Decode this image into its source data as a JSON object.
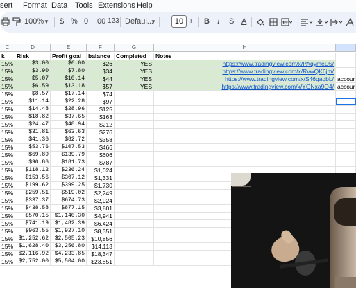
{
  "menu": [
    "sert",
    "Format",
    "Data",
    "Tools",
    "Extensions",
    "Help"
  ],
  "toolbar": {
    "zoom": "100%",
    "currency": "$",
    "percent": "%",
    "dec_less": ".0",
    "dec_more": ".00",
    "num_format": "123",
    "font": "Defaul...",
    "font_size": "10",
    "bold": "B",
    "italic": "I",
    "strike": "S",
    "text_color": "A",
    "fx": "fx"
  },
  "columns": [
    "C",
    "D",
    "E",
    "F",
    "G",
    "H"
  ],
  "headers": {
    "c": "k",
    "d": "Risk",
    "e": "Profit goal",
    "f": "balance",
    "g": "Completed",
    "h": "Notes"
  },
  "rows": [
    {
      "c": "15%",
      "d": "$3.00",
      "e": "$6.00",
      "f": "$26",
      "g": "YES",
      "h": "https://www.tradingview.com/x/PAqymeD5/",
      "i": ""
    },
    {
      "c": "15%",
      "d": "$3.90",
      "e": "$7.80",
      "f": "$34",
      "g": "YES",
      "h": "https://www.tradingview.com/x/RvwQK6jm/",
      "i": ""
    },
    {
      "c": "15%",
      "d": "$5.07",
      "e": "$10.14",
      "f": "$44",
      "g": "YES",
      "h": "https://www.tradingview.com/x/S46qaqbL/",
      "i": "account"
    },
    {
      "c": "15%",
      "d": "$6.59",
      "e": "$13.18",
      "f": "$57",
      "g": "YES",
      "h": "https://www.tradingview.com/x/YGNxa9O4/",
      "i": "account"
    },
    {
      "c": "15%",
      "d": "$8.57",
      "e": "$17.14",
      "f": "$74",
      "g": "",
      "h": "",
      "i": ""
    },
    {
      "c": "15%",
      "d": "$11.14",
      "e": "$22.28",
      "f": "$97",
      "g": "",
      "h": "",
      "i": ""
    },
    {
      "c": "15%",
      "d": "$14.48",
      "e": "$28.96",
      "f": "$125",
      "g": "",
      "h": "",
      "i": ""
    },
    {
      "c": "15%",
      "d": "$18.82",
      "e": "$37.65",
      "f": "$163",
      "g": "",
      "h": "",
      "i": ""
    },
    {
      "c": "15%",
      "d": "$24.47",
      "e": "$48.94",
      "f": "$212",
      "g": "",
      "h": "",
      "i": ""
    },
    {
      "c": "15%",
      "d": "$31.81",
      "e": "$63.63",
      "f": "$276",
      "g": "",
      "h": "",
      "i": ""
    },
    {
      "c": "15%",
      "d": "$41.36",
      "e": "$82.72",
      "f": "$358",
      "g": "",
      "h": "",
      "i": ""
    },
    {
      "c": "15%",
      "d": "$53.76",
      "e": "$107.53",
      "f": "$466",
      "g": "",
      "h": "",
      "i": ""
    },
    {
      "c": "15%",
      "d": "$69.89",
      "e": "$139.79",
      "f": "$606",
      "g": "",
      "h": "",
      "i": ""
    },
    {
      "c": "15%",
      "d": "$90.86",
      "e": "$181.73",
      "f": "$787",
      "g": "",
      "h": "",
      "i": ""
    },
    {
      "c": "15%",
      "d": "$118.12",
      "e": "$236.24",
      "f": "$1,024",
      "g": "",
      "h": "",
      "i": ""
    },
    {
      "c": "15%",
      "d": "$153.56",
      "e": "$307.12",
      "f": "$1,331",
      "g": "",
      "h": "",
      "i": ""
    },
    {
      "c": "15%",
      "d": "$199.62",
      "e": "$399.25",
      "f": "$1,730",
      "g": "",
      "h": "",
      "i": ""
    },
    {
      "c": "15%",
      "d": "$259.51",
      "e": "$519.02",
      "f": "$2,249",
      "g": "",
      "h": "",
      "i": ""
    },
    {
      "c": "15%",
      "d": "$337.37",
      "e": "$674.73",
      "f": "$2,924",
      "g": "",
      "h": "",
      "i": ""
    },
    {
      "c": "15%",
      "d": "$438.58",
      "e": "$877.15",
      "f": "$3,801",
      "g": "",
      "h": "",
      "i": ""
    },
    {
      "c": "15%",
      "d": "$570.15",
      "e": "$1,140.30",
      "f": "$4,941",
      "g": "",
      "h": "",
      "i": ""
    },
    {
      "c": "15%",
      "d": "$741.19",
      "e": "$1,482.39",
      "f": "$6,424",
      "g": "",
      "h": "",
      "i": ""
    },
    {
      "c": "15%",
      "d": "$963.55",
      "e": "$1,927.10",
      "f": "$8,351",
      "g": "",
      "h": "",
      "i": ""
    },
    {
      "c": "15%",
      "d": "$1,252.62",
      "e": "$2,505.23",
      "f": "$10,856",
      "g": "",
      "h": "",
      "i": ""
    },
    {
      "c": "15%",
      "d": "$1,628.40",
      "e": "$3,256.80",
      "f": "$14,113",
      "g": "",
      "h": "",
      "i": ""
    },
    {
      "c": "15%",
      "d": "$2,116.92",
      "e": "$4,233.85",
      "f": "$18,347",
      "g": "",
      "h": "",
      "i": ""
    },
    {
      "c": "15%",
      "d": "$2,752.00",
      "e": "$5,504.00",
      "f": "$23,851",
      "g": "",
      "h": "",
      "i": ""
    }
  ],
  "colors": {
    "completed_row": "#d9ead3",
    "link": "#1155cc",
    "selection": "#1a73e8",
    "toolbar_bg": "#edf2fa"
  }
}
